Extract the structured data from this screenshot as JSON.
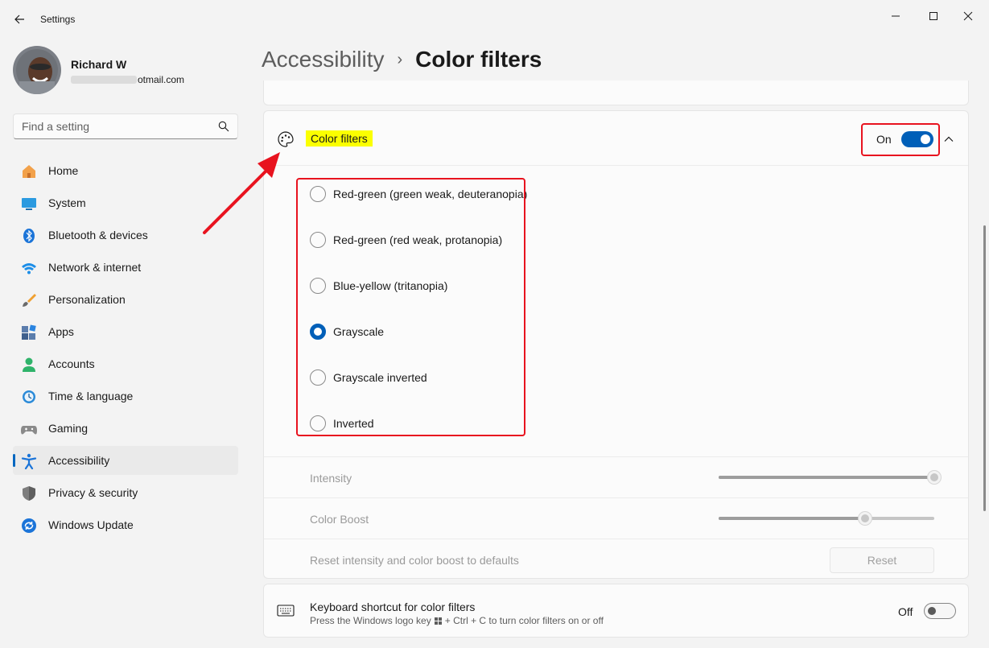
{
  "window": {
    "title": "Settings"
  },
  "profile": {
    "name": "Richard W",
    "email_suffix": "otmail.com"
  },
  "search": {
    "placeholder": "Find a setting"
  },
  "sidebar": {
    "items": [
      {
        "label": "Home",
        "icon": "home-icon"
      },
      {
        "label": "System",
        "icon": "system-icon"
      },
      {
        "label": "Bluetooth & devices",
        "icon": "bluetooth-icon"
      },
      {
        "label": "Network & internet",
        "icon": "wifi-icon"
      },
      {
        "label": "Personalization",
        "icon": "brush-icon"
      },
      {
        "label": "Apps",
        "icon": "apps-icon"
      },
      {
        "label": "Accounts",
        "icon": "accounts-icon"
      },
      {
        "label": "Time & language",
        "icon": "time-language-icon"
      },
      {
        "label": "Gaming",
        "icon": "gaming-icon"
      },
      {
        "label": "Accessibility",
        "icon": "accessibility-icon",
        "selected": true
      },
      {
        "label": "Privacy & security",
        "icon": "shield-icon"
      },
      {
        "label": "Windows Update",
        "icon": "update-icon"
      }
    ]
  },
  "breadcrumb": {
    "parent": "Accessibility",
    "separator": "›",
    "current": "Color filters"
  },
  "color_filters": {
    "title": "Color filters",
    "toggle_state": "On",
    "toggle_on": true,
    "options": [
      {
        "label": "Red-green (green weak, deuteranopia)",
        "checked": false
      },
      {
        "label": "Red-green (red weak, protanopia)",
        "checked": false
      },
      {
        "label": "Blue-yellow (tritanopia)",
        "checked": false
      },
      {
        "label": "Grayscale",
        "checked": true
      },
      {
        "label": "Grayscale inverted",
        "checked": false
      },
      {
        "label": "Inverted",
        "checked": false
      }
    ],
    "intensity": {
      "label": "Intensity",
      "value": 1.0
    },
    "color_boost": {
      "label": "Color Boost",
      "value": 0.68
    },
    "reset": {
      "label": "Reset intensity and color boost to defaults",
      "button": "Reset"
    }
  },
  "keyboard_shortcut": {
    "title": "Keyboard shortcut for color filters",
    "desc_before": "Press the Windows logo key",
    "desc_after": "+ Ctrl + C to turn color filters on or off",
    "toggle_state": "Off",
    "toggle_on": false
  },
  "colors": {
    "accent": "#005fb8",
    "highlight": "#fbff00",
    "annotation": "#e8131f"
  }
}
